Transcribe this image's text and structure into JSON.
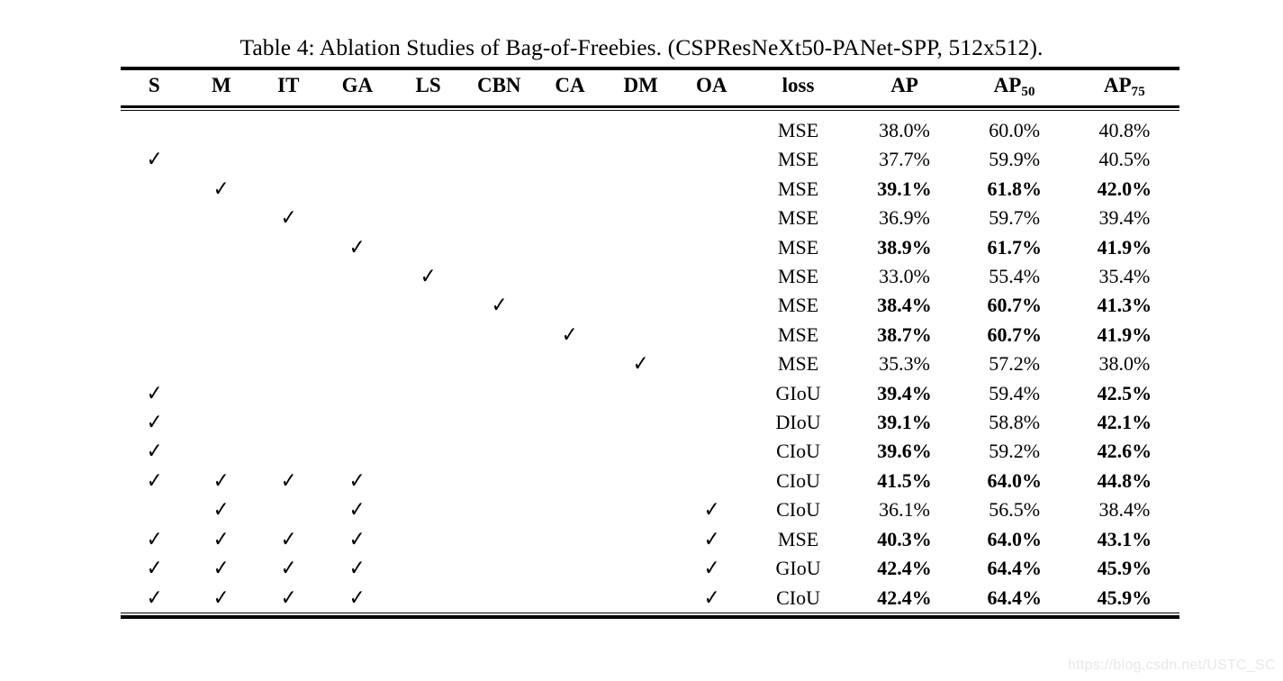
{
  "document": {
    "caption": "Table 4:  Ablation Studies of Bag-of-Freebies. (CSPResNeXt50-PANet-SPP, 512x512).",
    "watermark": "https://blog.csdn.net/USTC_SC",
    "check_glyph": "✓"
  },
  "table": {
    "headers": [
      {
        "label": "S",
        "sub": ""
      },
      {
        "label": "M",
        "sub": ""
      },
      {
        "label": "IT",
        "sub": ""
      },
      {
        "label": "GA",
        "sub": ""
      },
      {
        "label": "LS",
        "sub": ""
      },
      {
        "label": "CBN",
        "sub": ""
      },
      {
        "label": "CA",
        "sub": ""
      },
      {
        "label": "DM",
        "sub": ""
      },
      {
        "label": "OA",
        "sub": ""
      },
      {
        "label": "loss",
        "sub": ""
      },
      {
        "label": "AP",
        "sub": ""
      },
      {
        "label": "AP",
        "sub": "50"
      },
      {
        "label": "AP",
        "sub": "75"
      }
    ],
    "rows": [
      {
        "flags": [
          "",
          "",
          "",
          "",
          "",
          "",
          "",
          "",
          ""
        ],
        "loss": "MSE",
        "ap": "38.0%",
        "ap50": "60.0%",
        "ap75": "40.8%",
        "bold": {
          "ap": false,
          "ap50": false,
          "ap75": false
        }
      },
      {
        "flags": [
          "✓",
          "",
          "",
          "",
          "",
          "",
          "",
          "",
          ""
        ],
        "loss": "MSE",
        "ap": "37.7%",
        "ap50": "59.9%",
        "ap75": "40.5%",
        "bold": {
          "ap": false,
          "ap50": false,
          "ap75": false
        }
      },
      {
        "flags": [
          "",
          "✓",
          "",
          "",
          "",
          "",
          "",
          "",
          ""
        ],
        "loss": "MSE",
        "ap": "39.1%",
        "ap50": "61.8%",
        "ap75": "42.0%",
        "bold": {
          "ap": true,
          "ap50": true,
          "ap75": true
        }
      },
      {
        "flags": [
          "",
          "",
          "✓",
          "",
          "",
          "",
          "",
          "",
          ""
        ],
        "loss": "MSE",
        "ap": "36.9%",
        "ap50": "59.7%",
        "ap75": "39.4%",
        "bold": {
          "ap": false,
          "ap50": false,
          "ap75": false
        }
      },
      {
        "flags": [
          "",
          "",
          "",
          "✓",
          "",
          "",
          "",
          "",
          ""
        ],
        "loss": "MSE",
        "ap": "38.9%",
        "ap50": "61.7%",
        "ap75": "41.9%",
        "bold": {
          "ap": true,
          "ap50": true,
          "ap75": true
        }
      },
      {
        "flags": [
          "",
          "",
          "",
          "",
          "✓",
          "",
          "",
          "",
          ""
        ],
        "loss": "MSE",
        "ap": "33.0%",
        "ap50": "55.4%",
        "ap75": "35.4%",
        "bold": {
          "ap": false,
          "ap50": false,
          "ap75": false
        }
      },
      {
        "flags": [
          "",
          "",
          "",
          "",
          "",
          "✓",
          "",
          "",
          ""
        ],
        "loss": "MSE",
        "ap": "38.4%",
        "ap50": "60.7%",
        "ap75": "41.3%",
        "bold": {
          "ap": true,
          "ap50": true,
          "ap75": true
        }
      },
      {
        "flags": [
          "",
          "",
          "",
          "",
          "",
          "",
          "✓",
          "",
          ""
        ],
        "loss": "MSE",
        "ap": "38.7%",
        "ap50": "60.7%",
        "ap75": "41.9%",
        "bold": {
          "ap": true,
          "ap50": true,
          "ap75": true
        }
      },
      {
        "flags": [
          "",
          "",
          "",
          "",
          "",
          "",
          "",
          "✓",
          ""
        ],
        "loss": "MSE",
        "ap": "35.3%",
        "ap50": "57.2%",
        "ap75": "38.0%",
        "bold": {
          "ap": false,
          "ap50": false,
          "ap75": false
        }
      },
      {
        "flags": [
          "✓",
          "",
          "",
          "",
          "",
          "",
          "",
          "",
          ""
        ],
        "loss": "GIoU",
        "ap": "39.4%",
        "ap50": "59.4%",
        "ap75": "42.5%",
        "bold": {
          "ap": true,
          "ap50": false,
          "ap75": true
        }
      },
      {
        "flags": [
          "✓",
          "",
          "",
          "",
          "",
          "",
          "",
          "",
          ""
        ],
        "loss": "DIoU",
        "ap": "39.1%",
        "ap50": "58.8%",
        "ap75": "42.1%",
        "bold": {
          "ap": true,
          "ap50": false,
          "ap75": true
        }
      },
      {
        "flags": [
          "✓",
          "",
          "",
          "",
          "",
          "",
          "",
          "",
          ""
        ],
        "loss": "CIoU",
        "ap": "39.6%",
        "ap50": "59.2%",
        "ap75": "42.6%",
        "bold": {
          "ap": true,
          "ap50": false,
          "ap75": true
        }
      },
      {
        "flags": [
          "✓",
          "✓",
          "✓",
          "✓",
          "",
          "",
          "",
          "",
          ""
        ],
        "loss": "CIoU",
        "ap": "41.5%",
        "ap50": "64.0%",
        "ap75": "44.8%",
        "bold": {
          "ap": true,
          "ap50": true,
          "ap75": true
        }
      },
      {
        "flags": [
          "",
          "✓",
          "",
          "✓",
          "",
          "",
          "",
          "",
          "✓"
        ],
        "loss": "CIoU",
        "ap": "36.1%",
        "ap50": "56.5%",
        "ap75": "38.4%",
        "bold": {
          "ap": false,
          "ap50": false,
          "ap75": false
        }
      },
      {
        "flags": [
          "✓",
          "✓",
          "✓",
          "✓",
          "",
          "",
          "",
          "",
          "✓"
        ],
        "loss": "MSE",
        "ap": "40.3%",
        "ap50": "64.0%",
        "ap75": "43.1%",
        "bold": {
          "ap": true,
          "ap50": true,
          "ap75": true
        }
      },
      {
        "flags": [
          "✓",
          "✓",
          "✓",
          "✓",
          "",
          "",
          "",
          "",
          "✓"
        ],
        "loss": "GIoU",
        "ap": "42.4%",
        "ap50": "64.4%",
        "ap75": "45.9%",
        "bold": {
          "ap": true,
          "ap50": true,
          "ap75": true
        }
      },
      {
        "flags": [
          "✓",
          "✓",
          "✓",
          "✓",
          "",
          "",
          "",
          "",
          "✓"
        ],
        "loss": "CIoU",
        "ap": "42.4%",
        "ap50": "64.4%",
        "ap75": "45.9%",
        "bold": {
          "ap": true,
          "ap50": true,
          "ap75": true
        }
      }
    ]
  }
}
